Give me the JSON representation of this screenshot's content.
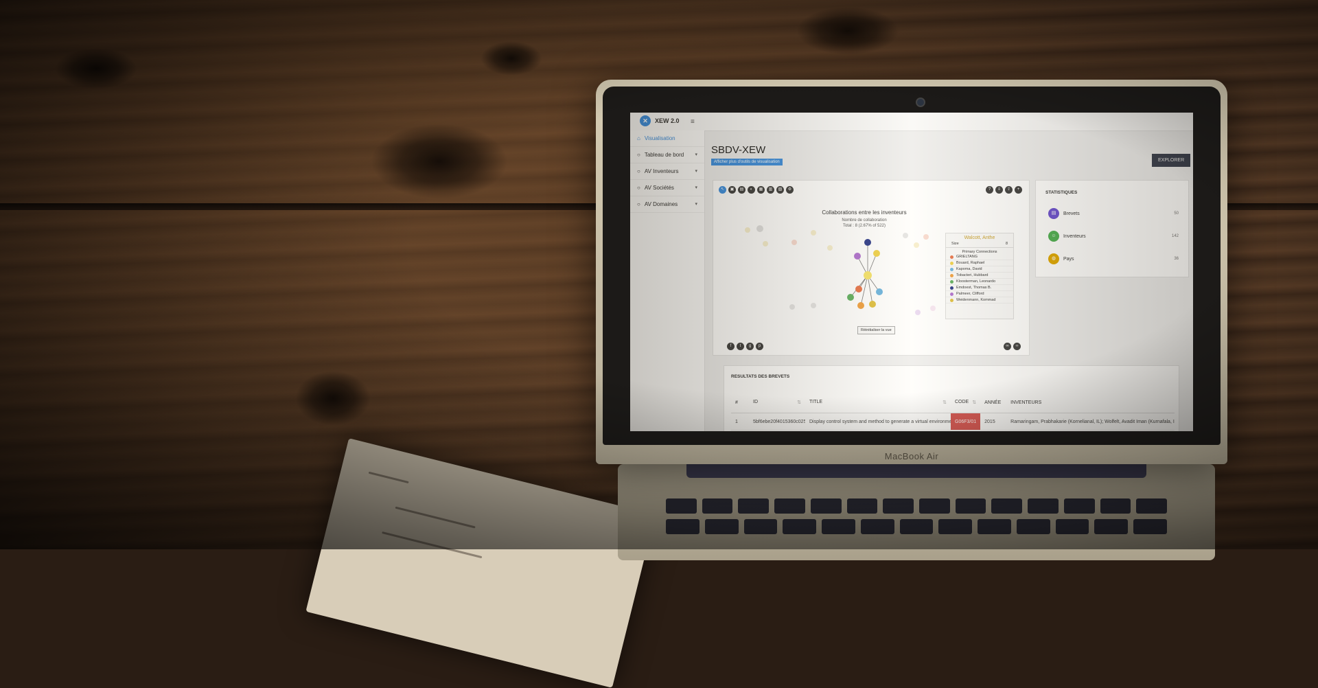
{
  "laptop": {
    "brand": "MacBook Air"
  },
  "app": {
    "logo_text": "XEW 2.0",
    "sidebar": [
      {
        "label": "Visualisation",
        "icon": "home-icon",
        "active": true,
        "arrow": ""
      },
      {
        "label": "Tableau de bord",
        "icon": "circle-icon",
        "active": false,
        "arrow": "▾"
      },
      {
        "label": "AV Inventeurs",
        "icon": "circle-icon",
        "active": false,
        "arrow": "▾"
      },
      {
        "label": "AV Sociétés",
        "icon": "circle-icon",
        "active": false,
        "arrow": "▾"
      },
      {
        "label": "AV Domaines",
        "icon": "circle-icon",
        "active": false,
        "arrow": "▾"
      }
    ],
    "page_title": "SBDV-XEW",
    "subtitle_button": "Afficher plus d'outils de visualisation",
    "explore_button": "EXPLORER"
  },
  "graph": {
    "title": "Collaborations entre les inventeurs",
    "subtitle_1": "Nombre de collaboration",
    "subtitle_2": "Total : 8 (2.67% of 522)",
    "legend_title": "Walcott, Anthe",
    "legend_size_label": "Size",
    "legend_size_value": "8",
    "legend_header": "Primary Connections",
    "legend_items": [
      {
        "name": "GRIELTANG",
        "color": "#e8744a"
      },
      {
        "name": "Bouard, Raphael",
        "color": "#f0d24a"
      },
      {
        "name": "Kapoma, David",
        "color": "#6cb4e0"
      },
      {
        "name": "Tobacteri, Hubbard",
        "color": "#f0a040"
      },
      {
        "name": "Kloosterman, Leonardo",
        "color": "#60b060"
      },
      {
        "name": "Emdoest, Thomas B.",
        "color": "#2c3a8a"
      },
      {
        "name": "Palmeer, Clifford",
        "color": "#b070d0"
      },
      {
        "name": "Weidenmann, Kommad",
        "color": "#e0c040"
      }
    ],
    "reset_label": "Réinitialiser la vue"
  },
  "stats": {
    "title": "STATISTIQUES",
    "items": [
      {
        "label": "Brevets",
        "value": "50",
        "color": "#6a4fd0",
        "icon": "document-icon"
      },
      {
        "label": "Inventeurs",
        "value": "142",
        "color": "#4caf50",
        "icon": "users-icon"
      },
      {
        "label": "Pays",
        "value": "36",
        "color": "#e0a800",
        "icon": "globe-icon"
      }
    ]
  },
  "results": {
    "title": "RESULTATS DES BREVETS",
    "columns": [
      "#",
      "ID",
      "TITLE",
      "CODE",
      "ANNÉE",
      "INVENTEURS"
    ],
    "rows": [
      [
        "1",
        "5bf6ebe20f4015360c0258e9",
        "Display control system and method to generate a virtual environment in a vehicle",
        "G06F3/01",
        "2015",
        "Ramaringam, Prabhakarie (Kornelianal, IL); Wolfelt, Avadit Iman (Kurnafala, IN)"
      ]
    ]
  },
  "colors": {
    "accent": "#3d8fe0",
    "code_red": "#d9534f"
  }
}
